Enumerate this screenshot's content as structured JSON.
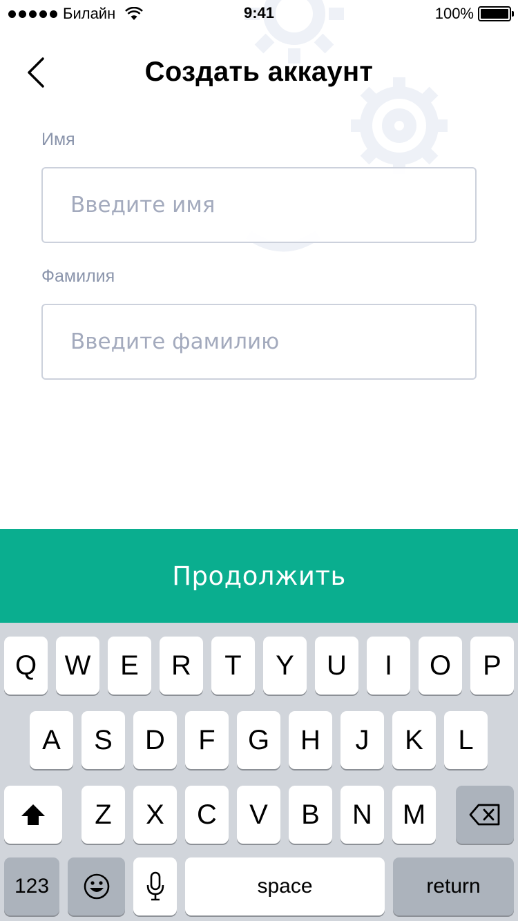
{
  "status_bar": {
    "carrier": "Билайн",
    "time": "9:41",
    "battery": "100%"
  },
  "header": {
    "title": "Создать аккаунт",
    "back_icon": "chevron-left-icon"
  },
  "form": {
    "first_name": {
      "label": "Имя",
      "placeholder": "Введите имя",
      "value": ""
    },
    "last_name": {
      "label": "Фамилия",
      "placeholder": "Введите фамилию",
      "value": ""
    }
  },
  "continue_button": {
    "label": "Продолжить",
    "color": "#0aae8f"
  },
  "keyboard": {
    "row1": [
      "Q",
      "W",
      "E",
      "R",
      "T",
      "Y",
      "U",
      "I",
      "O",
      "P"
    ],
    "row2": [
      "A",
      "S",
      "D",
      "F",
      "G",
      "H",
      "J",
      "K",
      "L"
    ],
    "row3": [
      "Z",
      "X",
      "C",
      "V",
      "B",
      "N",
      "M"
    ],
    "shift_icon": "shift-arrow-icon",
    "delete_icon": "backspace-icon",
    "numbers_label": "123",
    "emoji_icon": "emoji-icon",
    "mic_icon": "microphone-icon",
    "space_label": "space",
    "return_label": "return"
  },
  "colors": {
    "accent": "#0aae8f",
    "label": "#8a94ab",
    "input_border": "#ccd1dc",
    "keyboard_bg": "#d1d5db",
    "special_key": "#acb3bc"
  }
}
